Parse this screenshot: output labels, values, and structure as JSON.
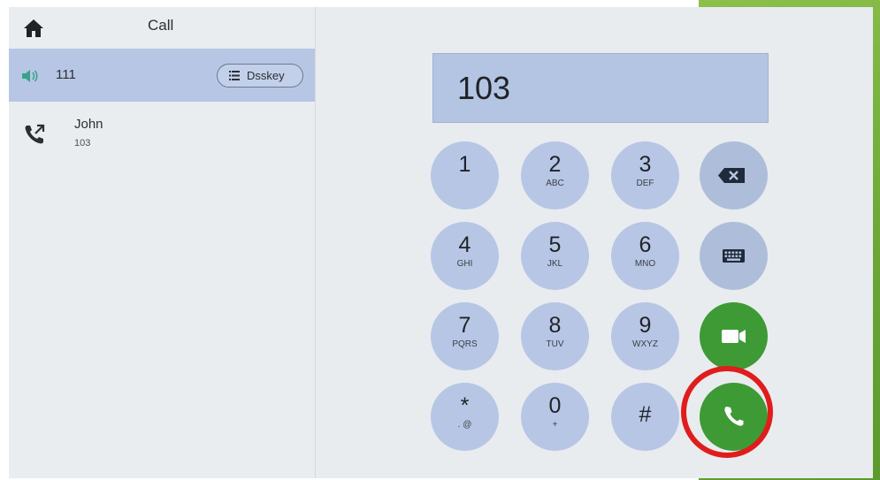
{
  "header": {
    "title": "Call"
  },
  "line": {
    "number": "111",
    "dsskey_label": "Dsskey"
  },
  "contact": {
    "name": "John",
    "number": "103"
  },
  "display": {
    "value": "103"
  },
  "keypad": {
    "k1": {
      "digit": "1",
      "letters": ""
    },
    "k2": {
      "digit": "2",
      "letters": "ABC"
    },
    "k3": {
      "digit": "3",
      "letters": "DEF"
    },
    "k4": {
      "digit": "4",
      "letters": "GHI"
    },
    "k5": {
      "digit": "5",
      "letters": "JKL"
    },
    "k6": {
      "digit": "6",
      "letters": "MNO"
    },
    "k7": {
      "digit": "7",
      "letters": "PQRS"
    },
    "k8": {
      "digit": "8",
      "letters": "TUV"
    },
    "k9": {
      "digit": "9",
      "letters": "WXYZ"
    },
    "kstar": {
      "digit": "*",
      "letters": ". @"
    },
    "k0": {
      "digit": "0",
      "letters": "+"
    },
    "khash": {
      "digit": "#",
      "letters": ""
    }
  },
  "icons": {
    "home": "home-icon",
    "speaker": "speaker-icon",
    "list": "list-icon",
    "outgoing": "outgoing-call-icon",
    "backspace": "backspace-icon",
    "keyboard": "keyboard-icon",
    "video": "video-call-icon",
    "phone": "phone-icon"
  },
  "colors": {
    "accent": "#b7c6e5",
    "call_green": "#3e9a34",
    "highlight": "#e01c1c"
  }
}
